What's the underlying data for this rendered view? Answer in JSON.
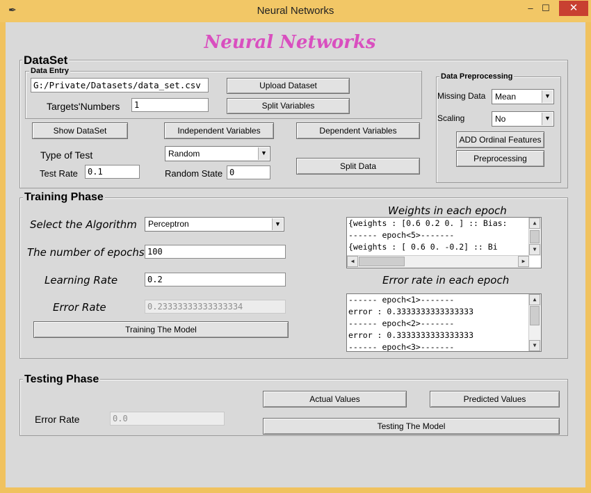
{
  "window": {
    "title": "Neural Networks",
    "minimize": "–",
    "maximize": "☐",
    "close": "✕"
  },
  "app_title": "Neural Networks",
  "dataset": {
    "frame_label": "DataSet",
    "data_entry": {
      "label": "Data Entry",
      "path_value": "G:/Private/Datasets/data_set.csv",
      "targets_label": "Targets'Numbers",
      "targets_value": "1",
      "upload_button": "Upload Dataset",
      "split_vars_button": "Split Variables"
    },
    "show_dataset_button": "Show DataSet",
    "independent_button": "Independent Variables",
    "dependent_button": "Dependent Variables",
    "type_of_test_label": "Type of Test",
    "type_of_test_value": "Random",
    "test_rate_label": "Test Rate",
    "test_rate_value": "0.1",
    "random_state_label": "Random State",
    "random_state_value": "0",
    "split_data_button": "Split Data",
    "preprocessing": {
      "label": "Data Preprocessing",
      "missing_label": "Missing Data",
      "missing_value": "Mean",
      "scaling_label": "Scaling",
      "scaling_value": "No",
      "ordinal_button": "ADD Ordinal Features",
      "preprocess_button": "Preprocessing"
    }
  },
  "training": {
    "frame_label": "Training Phase",
    "algorithm_label": "Select the Algorithm",
    "algorithm_value": "Perceptron",
    "epochs_label": "The number of epochs",
    "epochs_value": "100",
    "lr_label": "Learning Rate",
    "lr_value": "0.2",
    "error_label": "Error Rate",
    "error_value": "0.23333333333333334",
    "train_button": "Training The Model",
    "weights_title": "Weights in each epoch",
    "weights_lines": [
      "{weights : [0.6 0.2 0. ] :: Bias:",
      "------ epoch<5>-------",
      "{weights : [ 0.6  0.  -0.2] :: Bi"
    ],
    "error_title": "Error rate in each epoch",
    "error_lines": [
      "------ epoch<1>-------",
      "error : 0.3333333333333333",
      "------ epoch<2>-------",
      "error : 0.3333333333333333",
      "------ epoch<3>-------"
    ]
  },
  "testing": {
    "frame_label": "Testing Phase",
    "error_label": "Error Rate",
    "error_value": "0.0",
    "actual_button": "Actual Values",
    "predicted_button": "Predicted Values",
    "test_button": "Testing The Model"
  },
  "colors": {
    "title_pink": "#d94fbf",
    "background": "#d9d9d9",
    "titlebar": "#f2c766"
  },
  "icons": {
    "app": "feather-icon",
    "scroll_up": "triangle-up",
    "scroll_down": "triangle-down",
    "scroll_left": "triangle-left",
    "scroll_right": "triangle-right",
    "combo": "triangle-down"
  }
}
